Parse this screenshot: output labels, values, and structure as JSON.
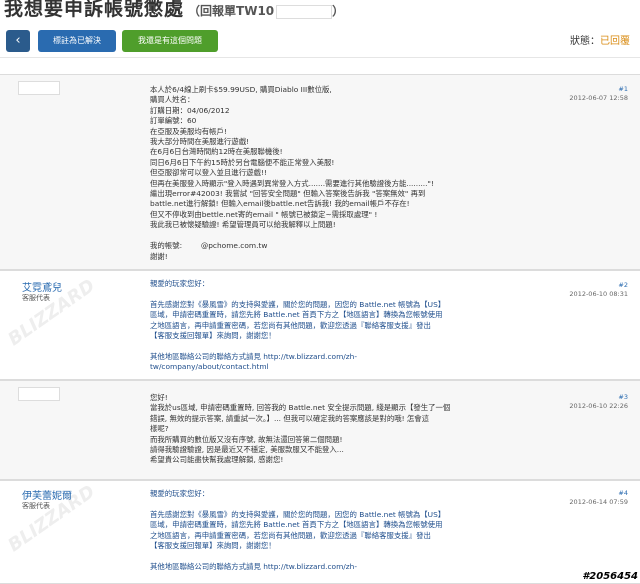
{
  "page": {
    "title": "我想要申訴帳號懲處",
    "ticket_label": "（回報單TW10",
    "ticket_close": "）",
    "status_label": "狀態：",
    "status_value": "已回覆",
    "status_color": "#d98b12"
  },
  "toolbar": {
    "back_icon": "‹",
    "solved_label": "標註為已解決",
    "unsolved_label": "我還是有這個問題"
  },
  "posts": [
    {
      "type": "user",
      "num": "#1",
      "date": "2012-06-07 12:58",
      "body": "本人於6/4線上刷卡$59.99USD, 購買Diablo III數位版,\n購買人姓名：\n訂購日期：04/06/2012\n訂單編號：60\n在亞服及美服均有帳戶!\n我大部分時間在美服進行遊戲!\n在6月6日台灣時間約12時在美服聯機後!\n同日6月6日下午約15時於另台電腦便不能正常登入美服!\n但亞服卻常可以登入並且進行遊戲!!\n但再在美服登入時顯示\"登入時遇到異常登入方式.......需要進行其他驗證後方能.........\"!\n繼出現error#42003! 我嘗試 \"回答安全問題\" 但輸入答案後告訴我 \"答案無效\" 再到\nbattle.net進行解鎖! 但輸入email後battle.net告訴我! 我的email帳戶不存在!\n但又不停收到由bettle.net寄的email \" 帳號已被鎖定~需採取處理\" !\n我此我已被懷疑驗證! 希望管理員可以給我解釋以上問題!\n\n我的帳號:        @pchome.com.tw\n謝謝!"
    },
    {
      "type": "staff",
      "num": "#2",
      "date": "2012-06-10 08:31",
      "name": "艾霓鳶兒",
      "role": "客服代表",
      "body": "親愛的玩家您好：\n\n首先感謝您對《暴風雪》的支持與愛護，關於您的問題，因您的 Battle.net 帳號為【US】\n區域，申請密碼重置時，請您先將 Battle.net 首頁下方之【地區語言】轉換為您帳號使用\n之地區語言，再申請重置密碼，若您尚有其他問題，歡迎您透過『聯絡客服支援』發出\n【客服支援回報單】來詢問，謝謝您！\n\n其他地區聯絡公司的聯絡方式請見 http://tw.blizzard.com/zh-\ntw/company/about/contact.html"
    },
    {
      "type": "user",
      "num": "#3",
      "date": "2012-06-10 22:26",
      "body": "您好!\n當我於us區域, 申請密碼重置時, 回答我的 Battle.net 安全提示問題, 綫是顯示【發生了一個\n錯誤, 無效的提示答案, 請重試一次。】... 但我可以確定我的答案應該是對的哦! 怎會這\n樣呢?\n而我所購買的數位版又沒有序號, 故無法還回答第二個問題!\n請得我驗證驗證, 因是最近又不穩定, 美服款服又不能登入...\n希望貴公司能盡快幫我處理解鎖, 感謝您!"
    },
    {
      "type": "staff",
      "num": "#4",
      "date": "2012-06-14 07:59",
      "name": "伊芙蕾妮爾",
      "role": "客服代表",
      "body": "親愛的玩家您好：\n\n首先感謝您對《暴風雪》的支持與愛護，關於您的問題，因您的 Battle.net 帳號為【US】\n區域，申請密碼重置時，請您先將 Battle.net 首頁下方之【地區語言】轉換為您帳號使用\n之地區語言，再申請重置密碼，若您尚有其他問題，歡迎您透過『聯絡客服支援』發出\n【客服支援回報單】來詢問，謝謝您！\n\n其他地區聯絡公司的聯絡方式請見 http://tw.blizzard.com/zh-"
    }
  ],
  "watermark_text": "BLIZZARD",
  "footer_tag": "#2056454"
}
